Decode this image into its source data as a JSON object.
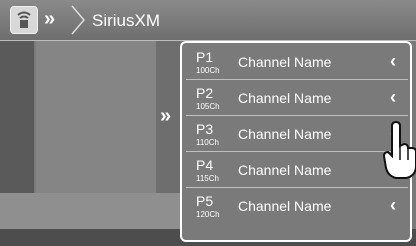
{
  "header": {
    "source_icon": "satellite-radio-icon",
    "back_icon": "double-chevron-left-icon",
    "title": "SiriusXM"
  },
  "side": {
    "expand_icon": "double-chevron-right-icon"
  },
  "presets": [
    {
      "preset": "P1",
      "channel": "100Ch",
      "name": "Channel Name",
      "action_icon": "chevron-left-icon"
    },
    {
      "preset": "P2",
      "channel": "105Ch",
      "name": "Channel Name",
      "action_icon": "chevron-left-icon"
    },
    {
      "preset": "P3",
      "channel": "110Ch",
      "name": "Channel Name",
      "action_icon": "chevron-left-icon"
    },
    {
      "preset": "P4",
      "channel": "115Ch",
      "name": "Channel Name",
      "action_icon": "chevron-left-icon"
    },
    {
      "preset": "P5",
      "channel": "120Ch",
      "name": "Channel Name",
      "action_icon": "chevron-left-icon"
    }
  ],
  "overlay": {
    "pointer_icon": "hand-pointer-icon"
  }
}
